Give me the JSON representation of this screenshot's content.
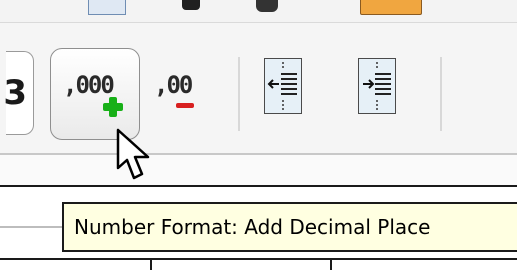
{
  "toolbar": {
    "partial_button_glyph": "3",
    "add_decimal_glyph": ",000",
    "remove_decimal_glyph": ",00",
    "add_decimal_icon": "plus-icon",
    "remove_decimal_icon": "minus-icon",
    "decrease_indent_icon": "decrease-indent-icon",
    "increase_indent_icon": "increase-indent-icon"
  },
  "tooltip": {
    "text": "Number Format: Add Decimal Place"
  },
  "colors": {
    "plus": "#18b018",
    "minus": "#d82020",
    "tooltip_bg": "#ffffe1",
    "indent_bg": "#e6f0f7"
  }
}
